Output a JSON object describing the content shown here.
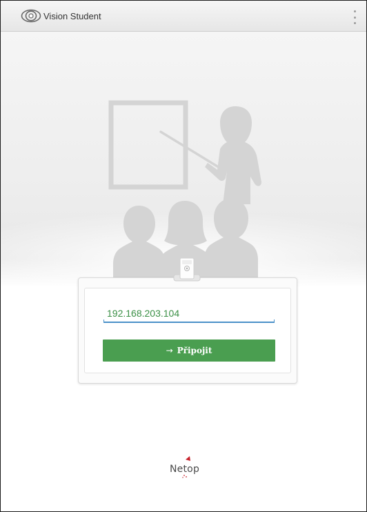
{
  "app": {
    "title": "Vision Student",
    "icon": "eye-icon",
    "menu_icon": "vertical-dots-icon"
  },
  "hero": {
    "illustration": "classroom-teacher-students-illustration"
  },
  "login": {
    "server_address_value": "192.168.203.104",
    "connect_arrow": "→",
    "connect_label": "Připojit",
    "badge_icon": "badge-clip-icon"
  },
  "footer": {
    "logo_text": "Netop"
  },
  "colors": {
    "accent_green": "#4a9e50",
    "input_text_green": "#3a8f45",
    "input_underline_blue": "#4a90c8",
    "illustration_gray": "#d6d6d6",
    "logo_red": "#c8222c"
  }
}
